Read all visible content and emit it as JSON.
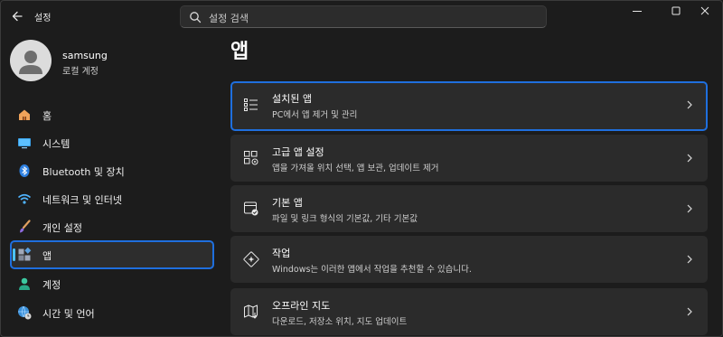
{
  "window": {
    "title": "설정",
    "search_placeholder": "설정 검색"
  },
  "account": {
    "name": "samsung",
    "type": "로컬 계정"
  },
  "sidebar": {
    "items": [
      {
        "label": "홈",
        "icon": "home-icon"
      },
      {
        "label": "시스템",
        "icon": "system-icon"
      },
      {
        "label": "Bluetooth 및 장치",
        "icon": "bluetooth-icon"
      },
      {
        "label": "네트워크 및 인터넷",
        "icon": "wifi-icon"
      },
      {
        "label": "개인 설정",
        "icon": "brush-icon"
      },
      {
        "label": "앱",
        "icon": "apps-icon",
        "selected": true
      },
      {
        "label": "계정",
        "icon": "person-icon"
      },
      {
        "label": "시간 및 언어",
        "icon": "globe-clock-icon"
      }
    ]
  },
  "main": {
    "title": "앱",
    "cards": [
      {
        "title": "설치된 앱",
        "subtitle": "PC에서 앱 제거 및 관리",
        "icon": "installed-apps-icon",
        "selected": true
      },
      {
        "title": "고급 앱 설정",
        "subtitle": "앱을 가져올 위치 선택, 앱 보관, 업데이트 제거",
        "icon": "advanced-app-settings-icon"
      },
      {
        "title": "기본 앱",
        "subtitle": "파일 및 링크 형식의 기본값, 기타 기본값",
        "icon": "default-apps-icon"
      },
      {
        "title": "작업",
        "subtitle": "Windows는 이러한 앱에서 작업을 추천할 수 있습니다.",
        "icon": "actions-icon"
      },
      {
        "title": "오프라인 지도",
        "subtitle": "다운로드, 저장소 위치, 지도 업데이트",
        "icon": "offline-maps-icon"
      }
    ]
  },
  "colors": {
    "background": "#1c1c1c",
    "card": "#2b2b2b",
    "highlight": "#1f6fde",
    "accent": "#4cc2ff"
  }
}
